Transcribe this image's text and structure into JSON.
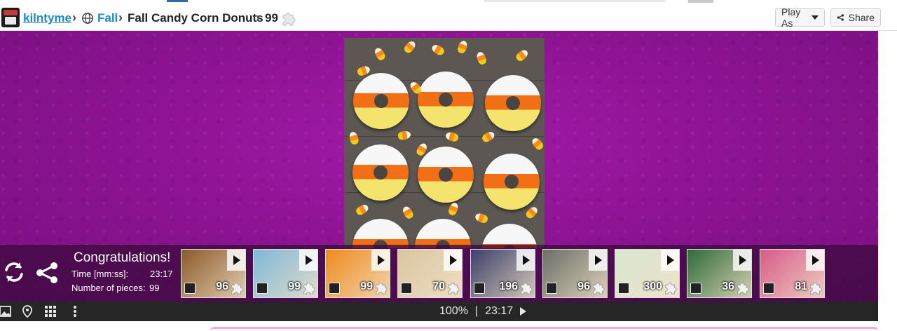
{
  "header": {
    "user": "kilntyme",
    "category": "Fall",
    "title": "Fall Candy Corn Donuts",
    "pieces": "99",
    "play_as": "Play As",
    "share": "Share"
  },
  "congrats": {
    "heading": "Congratulations!",
    "time_label": "Time [mm:ss]:",
    "time_value": "23:17",
    "pieces_label": "Number of pieces:",
    "pieces_value": "99"
  },
  "related": [
    {
      "count": "96",
      "tone": "#8a5a2a",
      "icon": "cupcake-thumbnail"
    },
    {
      "count": "99",
      "tone": "#7fb8d8",
      "icon": "cookies-thumbnail"
    },
    {
      "count": "99",
      "tone": "#f08a1e",
      "icon": "pumpkin-cookies-thumbnail"
    },
    {
      "count": "70",
      "tone": "#d9c6a0",
      "icon": "sunflower-cupcakes-thumbnail"
    },
    {
      "count": "196",
      "tone": "#3a3f6a",
      "icon": "haunted-house-thumbnail"
    },
    {
      "count": "96",
      "tone": "#6b6f68",
      "icon": "pumpkin-truck-thumbnail"
    },
    {
      "count": "300",
      "tone": "#d8e6d0",
      "icon": "watermelon-cookies-thumbnail"
    },
    {
      "count": "36",
      "tone": "#2f6b3a",
      "icon": "monster-cookies-thumbnail"
    },
    {
      "count": "81",
      "tone": "#d85a8a",
      "icon": "candy-pops-thumbnail"
    }
  ],
  "toolbar": {
    "zoom": "100%",
    "divider": "|",
    "time": "23:17"
  },
  "colors": {
    "link": "#1a8bc9",
    "stage": "#8e1494",
    "toolbar": "#262626"
  }
}
